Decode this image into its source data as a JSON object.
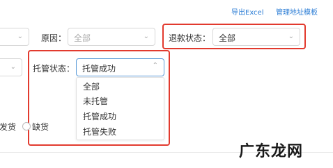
{
  "header": {
    "export_link": "导出Excel",
    "template_link": "管理地址模板"
  },
  "filters": {
    "reason": {
      "label": "原因：",
      "value": "全部"
    },
    "refund_status": {
      "label": "退款状态：",
      "value": "全部"
    },
    "custody_status": {
      "label": "托管状态：",
      "value": "托管成功",
      "options": [
        "全部",
        "未托管",
        "托管成功",
        "托管失败"
      ]
    }
  },
  "shipping": {
    "partial_label": "发货",
    "out_of_stock_label": "缺货"
  },
  "watermark": {
    "text": "广东龙网"
  }
}
